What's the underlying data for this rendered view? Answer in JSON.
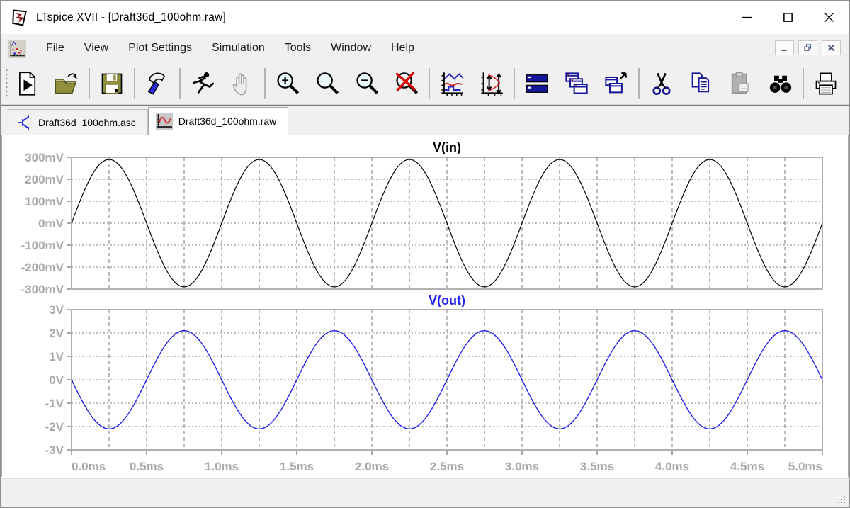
{
  "window": {
    "title": "LTspice XVII - [Draft36d_100ohm.raw]",
    "app_icon": "ltspice-logo",
    "controls": [
      "minimize",
      "maximize",
      "close"
    ]
  },
  "menubar": {
    "icon": "plot-window-icon",
    "items": [
      {
        "label": "File",
        "mnemonic": 0
      },
      {
        "label": "View",
        "mnemonic": 0
      },
      {
        "label": "Plot Settings",
        "mnemonic": 0
      },
      {
        "label": "Simulation",
        "mnemonic": 0
      },
      {
        "label": "Tools",
        "mnemonic": 0
      },
      {
        "label": "Window",
        "mnemonic": 0
      },
      {
        "label": "Help",
        "mnemonic": 0
      }
    ],
    "mdi_controls": [
      "minimize",
      "restore",
      "close"
    ]
  },
  "toolbar": {
    "groups": [
      [
        {
          "icon": "new-schematic"
        },
        {
          "icon": "open-file"
        }
      ],
      [
        {
          "icon": "save"
        }
      ],
      [
        {
          "icon": "control-panel-hammer"
        }
      ],
      [
        {
          "icon": "run"
        },
        {
          "icon": "halt",
          "disabled": true
        }
      ],
      [
        {
          "icon": "zoom-in"
        },
        {
          "icon": "zoom-area"
        },
        {
          "icon": "zoom-out"
        },
        {
          "icon": "zoom-full-extents"
        }
      ],
      [
        {
          "icon": "autorange-y-axis"
        },
        {
          "icon": "fit-y-axis"
        }
      ],
      [
        {
          "icon": "tile-horizontal"
        },
        {
          "icon": "cascade-windows"
        },
        {
          "icon": "float-window"
        }
      ],
      [
        {
          "icon": "cut"
        },
        {
          "icon": "copy"
        },
        {
          "icon": "paste",
          "disabled": true
        },
        {
          "icon": "find"
        }
      ],
      [
        {
          "icon": "print"
        },
        {
          "icon": "print-preview"
        }
      ]
    ]
  },
  "tabs": [
    {
      "label": "Draft36d_100ohm.asc",
      "icon": "schematic-icon",
      "active": false
    },
    {
      "label": "Draft36d_100ohm.raw",
      "icon": "waveform-icon",
      "active": true
    }
  ],
  "chart_data": [
    {
      "type": "line",
      "title": "V(in)",
      "title_color": "#000000",
      "trace_color": "#000000",
      "x_unit": "ms",
      "x_range_ms": [
        0,
        5
      ],
      "x_gridline_step_ms": 0.25,
      "y_ticks": [
        "300mV",
        "200mV",
        "100mV",
        "0mV",
        "-100mV",
        "-200mV",
        "-300mV"
      ],
      "y_lim_mV": [
        -300,
        300
      ],
      "grid": true,
      "signal": {
        "shape": "sine",
        "amplitude_mV": 290,
        "dc_offset_mV": 0,
        "frequency_hz": 1000,
        "starts": "rising",
        "cycles_shown": 5
      }
    },
    {
      "type": "line",
      "title": "V(out)",
      "title_color": "#2121f0",
      "trace_color": "#2121f0",
      "x_unit": "ms",
      "x_range_ms": [
        0,
        5
      ],
      "x_gridline_step_ms": 0.25,
      "x_ticks": [
        "0.0ms",
        "0.5ms",
        "1.0ms",
        "1.5ms",
        "2.0ms",
        "2.5ms",
        "3.0ms",
        "3.5ms",
        "4.0ms",
        "4.5ms",
        "5.0ms"
      ],
      "y_ticks": [
        "3V",
        "2V",
        "1V",
        "0V",
        "-1V",
        "-2V",
        "-3V"
      ],
      "y_lim_V": [
        -3,
        3
      ],
      "grid": true,
      "signal": {
        "shape": "sine",
        "amplitude_V": 2.1,
        "dc_offset_V": 0,
        "frequency_hz": 1000,
        "starts": "falling",
        "phase_relative_to_Vin_deg": 180,
        "cycles_shown": 5
      }
    }
  ],
  "axis_style": {
    "tick_label_color": "#a8a8a8",
    "grid_color": "#7a7a7a",
    "pane_border_color": "#909090"
  },
  "statusbar": {
    "text": ""
  }
}
